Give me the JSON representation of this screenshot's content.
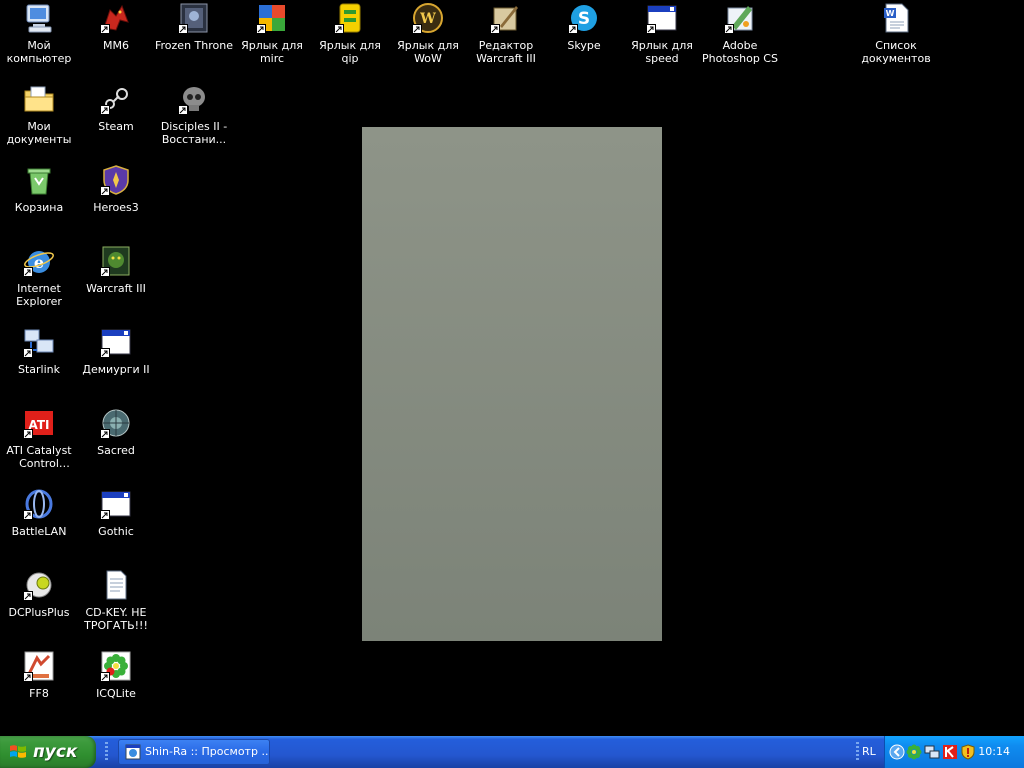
{
  "desktop": {
    "icons": [
      {
        "label": "Мой компьютер",
        "icon": "my-computer-icon"
      },
      {
        "label": "ММ6",
        "icon": "dragon-icon"
      },
      {
        "label": "Frozen Throne",
        "icon": "frozen-throne-icon"
      },
      {
        "label": "Ярлык для mirc",
        "icon": "mirc-icon"
      },
      {
        "label": "Ярлык для qip",
        "icon": "qip-icon"
      },
      {
        "label": "Ярлык для WoW",
        "icon": "wow-icon"
      },
      {
        "label": "Редактор Warcraft III",
        "icon": "warcraft-editor-icon"
      },
      {
        "label": "Skype",
        "icon": "skype-icon"
      },
      {
        "label": "Ярлык для speed",
        "icon": "window-icon"
      },
      {
        "label": "Adobe Photoshop CS",
        "icon": "photoshop-icon"
      },
      {
        "label": "Список документов",
        "icon": "word-document-icon"
      },
      {
        "label": "Мои документы",
        "icon": "my-documents-icon"
      },
      {
        "label": "Steam",
        "icon": "steam-icon"
      },
      {
        "label": "Disciples II - Восстани...",
        "icon": "skull-icon"
      },
      {
        "label": "Корзина",
        "icon": "recycle-bin-icon"
      },
      {
        "label": "Heroes3",
        "icon": "heroes-shield-icon"
      },
      {
        "label": "Internet Explorer",
        "icon": "internet-explorer-icon"
      },
      {
        "label": "Warcraft III",
        "icon": "warcraft-icon"
      },
      {
        "label": "Starlink",
        "icon": "network-computers-icon"
      },
      {
        "label": "Демиурги II",
        "icon": "window-icon"
      },
      {
        "label": "ATI Catalyst Control Center",
        "icon": "ati-icon"
      },
      {
        "label": "Sacred",
        "icon": "sacred-icon"
      },
      {
        "label": "BattleLAN",
        "icon": "battlelan-icon"
      },
      {
        "label": "Gothic",
        "icon": "window-icon"
      },
      {
        "label": "DCPlusPlus",
        "icon": "dcplusplus-icon"
      },
      {
        "label": "CD-KEY. НЕ ТРОГАТЬ!!!",
        "icon": "text-document-icon"
      },
      {
        "label": "FF8",
        "icon": "ff8-icon"
      },
      {
        "label": "ICQLite",
        "icon": "icq-flower-icon"
      }
    ]
  },
  "taskbar": {
    "start_label": "пуск",
    "tasks": [
      {
        "label": "Shin-Ra :: Просмотр ..."
      }
    ],
    "language": "RL",
    "clock": "10:14"
  }
}
